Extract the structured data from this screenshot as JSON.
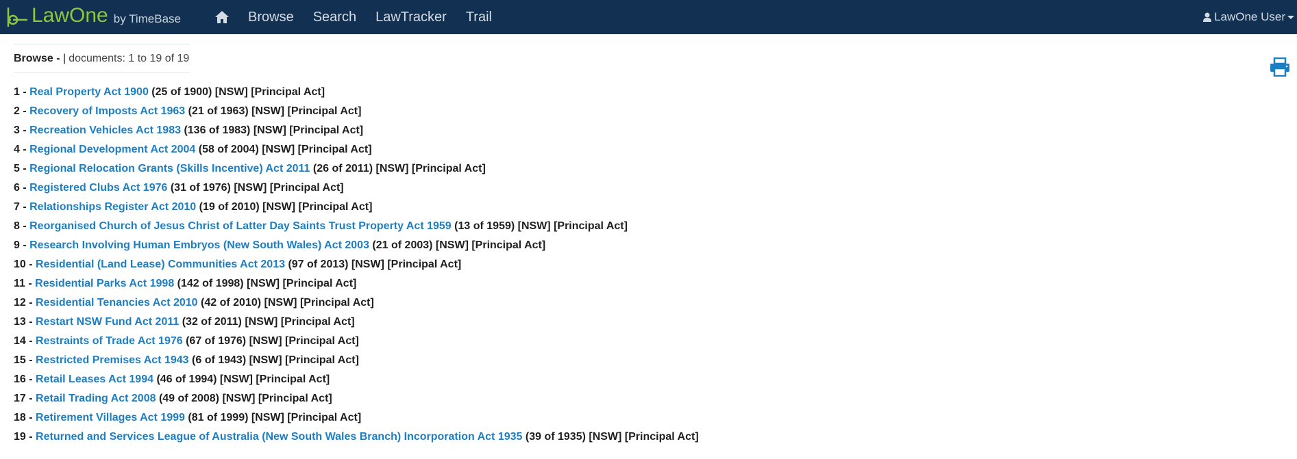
{
  "navbar": {
    "brand": "LawOne",
    "brand_by": "by TimeBase",
    "nav_items": [
      "Browse",
      "Search",
      "LawTracker",
      "Trail"
    ],
    "user": "LawOne User",
    "colors": {
      "background": "#123052",
      "brand": "#8dc63f",
      "link": "#1d7ec2"
    }
  },
  "page": {
    "browse_label": "Browse -",
    "separator": "|",
    "doc_count": "documents: 1 to 19 of 19"
  },
  "documents": [
    {
      "num": "1 -",
      "title": "Real Property Act 1900",
      "meta": "(25 of 1900) [NSW] [Principal Act]"
    },
    {
      "num": "2 -",
      "title": "Recovery of Imposts Act 1963",
      "meta": "(21 of 1963) [NSW] [Principal Act]"
    },
    {
      "num": "3 -",
      "title": "Recreation Vehicles Act 1983",
      "meta": "(136 of 1983) [NSW] [Principal Act]"
    },
    {
      "num": "4 -",
      "title": "Regional Development Act 2004",
      "meta": "(58 of 2004) [NSW] [Principal Act]"
    },
    {
      "num": "5 -",
      "title": "Regional Relocation Grants (Skills Incentive) Act 2011",
      "meta": "(26 of 2011) [NSW] [Principal Act]"
    },
    {
      "num": "6 -",
      "title": "Registered Clubs Act 1976",
      "meta": "(31 of 1976) [NSW] [Principal Act]"
    },
    {
      "num": "7 -",
      "title": "Relationships Register Act 2010",
      "meta": "(19 of 2010) [NSW] [Principal Act]"
    },
    {
      "num": "8 -",
      "title": "Reorganised Church of Jesus Christ of Latter Day Saints Trust Property Act 1959",
      "meta": "(13 of 1959) [NSW] [Principal Act]"
    },
    {
      "num": "9 -",
      "title": "Research Involving Human Embryos (New South Wales) Act 2003",
      "meta": "(21 of 2003) [NSW] [Principal Act]"
    },
    {
      "num": "10 -",
      "title": "Residential (Land Lease) Communities Act 2013",
      "meta": "(97 of 2013) [NSW] [Principal Act]"
    },
    {
      "num": "11 -",
      "title": "Residential Parks Act 1998",
      "meta": "(142 of 1998) [NSW] [Principal Act]"
    },
    {
      "num": "12 -",
      "title": "Residential Tenancies Act 2010",
      "meta": "(42 of 2010) [NSW] [Principal Act]"
    },
    {
      "num": "13 -",
      "title": "Restart NSW Fund Act 2011",
      "meta": "(32 of 2011) [NSW] [Principal Act]"
    },
    {
      "num": "14 -",
      "title": "Restraints of Trade Act 1976",
      "meta": "(67 of 1976) [NSW] [Principal Act]"
    },
    {
      "num": "15 -",
      "title": "Restricted Premises Act 1943",
      "meta": "(6 of 1943) [NSW] [Principal Act]"
    },
    {
      "num": "16 -",
      "title": "Retail Leases Act 1994",
      "meta": "(46 of 1994) [NSW] [Principal Act]"
    },
    {
      "num": "17 -",
      "title": "Retail Trading Act 2008",
      "meta": "(49 of 2008) [NSW] [Principal Act]"
    },
    {
      "num": "18 -",
      "title": "Retirement Villages Act 1999",
      "meta": "(81 of 1999) [NSW] [Principal Act]"
    },
    {
      "num": "19 -",
      "title": "Returned and Services League of Australia (New South Wales Branch) Incorporation Act 1935",
      "meta": "(39 of 1935) [NSW] [Principal Act]"
    }
  ]
}
